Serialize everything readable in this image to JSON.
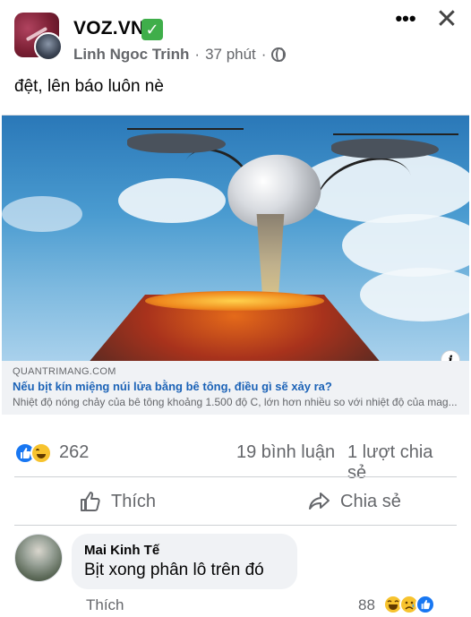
{
  "header": {
    "group_name": "VOZ.VN",
    "verified_mark": "✓",
    "author": "Linh Ngoc Trinh",
    "separator": "·",
    "time": "37 phút",
    "more_label": "•••",
    "close_label": "✕"
  },
  "post": {
    "text": "đệt, lên báo luôn nè"
  },
  "link_preview": {
    "domain": "QUANTRIMANG.COM",
    "title": "Nếu bịt kín miệng núi lửa bằng bê tông, điều gì sẽ xảy ra?",
    "description": "Nhiệt độ nóng chảy của bê tông khoảng 1.500 độ C, lớn hơn nhiều so với nhiệt độ của mag...",
    "info_label": "i"
  },
  "stats": {
    "reaction_count": "262",
    "comments": "19 bình luận",
    "shares": "1 lượt chia sẻ"
  },
  "actions": {
    "like_label": "Thích",
    "share_label": "Chia sẻ"
  },
  "comment": {
    "author": "Mai Kinh Tế",
    "text": "Bịt xong phân lô trên đó",
    "like_label": "Thích",
    "reaction_count": "88"
  },
  "colors": {
    "accent_blue": "#1877f2",
    "meta_gray": "#65676b",
    "verified_green": "#3fae4a",
    "link_title_blue": "#1c63b7"
  },
  "icons": [
    "more-icon",
    "close-icon",
    "globe-icon",
    "like-thumb-icon",
    "share-arrow-icon",
    "like-reaction-icon",
    "haha-reaction-icon",
    "sad-reaction-icon",
    "info-icon"
  ]
}
